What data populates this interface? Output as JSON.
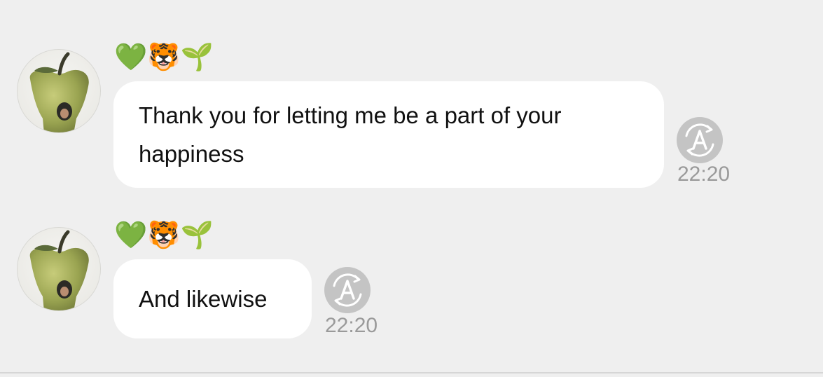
{
  "messages": [
    {
      "sender": "💚🐯🌱",
      "text": "Thank you for letting me be a part of your happiness",
      "time": "22:20",
      "status_icon": "translate-icon"
    },
    {
      "sender": "💚🐯🌱",
      "text": "And likewise",
      "time": "22:20",
      "status_icon": "translate-icon"
    }
  ],
  "colors": {
    "background": "#efefef",
    "bubble": "#ffffff",
    "timestamp": "#9a9a9a",
    "icon": "#c4c4c4"
  }
}
